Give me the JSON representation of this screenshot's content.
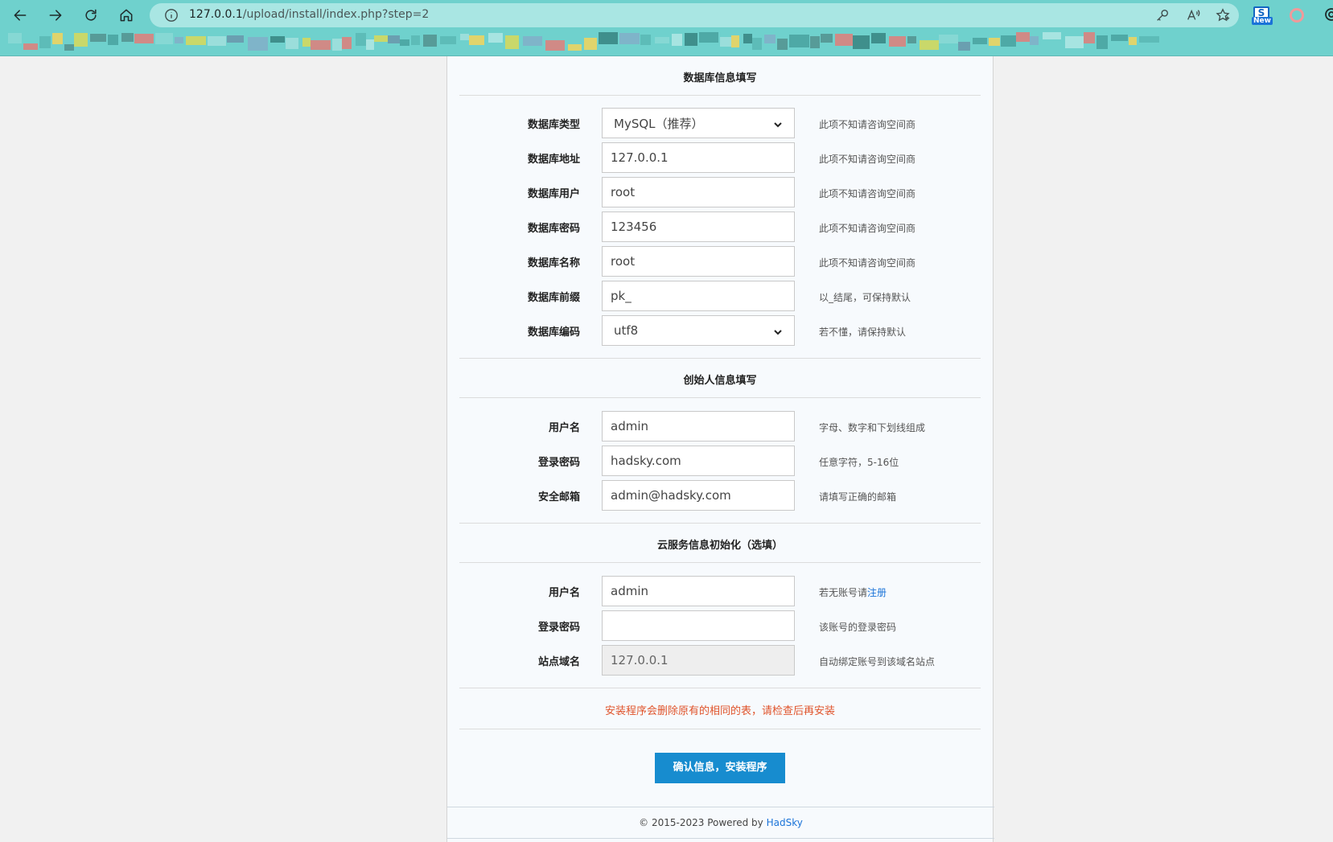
{
  "browser": {
    "url_host": "127.0.0.1",
    "url_path": "/upload/install/index.php?step=2",
    "ext_label": "S",
    "ext_badge": "New"
  },
  "db": {
    "title": "数据库信息填写",
    "rows": [
      {
        "label": "数据库类型",
        "value": "MySQL（推荐）",
        "hint": "此项不知请咨询空间商"
      },
      {
        "label": "数据库地址",
        "value": "127.0.0.1",
        "hint": "此项不知请咨询空间商"
      },
      {
        "label": "数据库用户",
        "value": "root",
        "hint": "此项不知请咨询空间商"
      },
      {
        "label": "数据库密码",
        "value": "123456",
        "hint": "此项不知请咨询空间商"
      },
      {
        "label": "数据库名称",
        "value": "root",
        "hint": "此项不知请咨询空间商"
      },
      {
        "label": "数据库前缀",
        "value": "pk_",
        "hint": "以_结尾，可保持默认"
      },
      {
        "label": "数据库编码",
        "value": "utf8",
        "hint": "若不懂，请保持默认"
      }
    ]
  },
  "founder": {
    "title": "创始人信息填写",
    "rows": [
      {
        "label": "用户名",
        "value": "admin",
        "hint": "字母、数字和下划线组成"
      },
      {
        "label": "登录密码",
        "value": "hadsky.com",
        "hint": "任意字符，5-16位"
      },
      {
        "label": "安全邮箱",
        "value": "admin@hadsky.com",
        "hint": "请填写正确的邮箱"
      }
    ]
  },
  "cloud": {
    "title": "云服务信息初始化（选填）",
    "rows": [
      {
        "label": "用户名",
        "value": "admin",
        "hint": "若无账号请",
        "hint_link": "注册"
      },
      {
        "label": "登录密码",
        "value": "",
        "hint": "该账号的登录密码"
      },
      {
        "label": "站点域名",
        "value": "127.0.0.1",
        "hint": "自动绑定账号到该域名站点"
      }
    ]
  },
  "warning": "安装程序会删除原有的相同的表，请检查后再安装",
  "submit_label": "确认信息，安装程序",
  "footer": {
    "prefix": "© 2015-2023 Powered by ",
    "brand": "HadSky"
  },
  "colors": {
    "chrome": "#6fd1cd",
    "primary": "#178ccf",
    "warning": "#e0542c",
    "link": "#1a73d8"
  }
}
